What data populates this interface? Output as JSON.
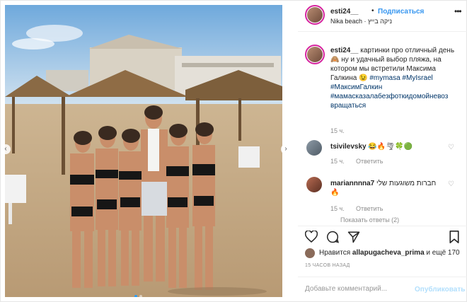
{
  "post": {
    "username": "esti24__",
    "separator": "•",
    "follow_label": "Подписаться",
    "location": "Nika beach · ניקה בייץ",
    "more_icon": "more-horizontal-icon"
  },
  "caption": {
    "username": "esti24__",
    "text": "картинки про отличный день 🙈 ну и удачный выбор пляжа, на котором мы встретили Максима Галкина 😉",
    "hashtags": "#mymasa #MyIsrael #МаксимГалкин #мамасказалабезфоткидомойневоз вращаться",
    "time": "15 ч."
  },
  "comments": [
    {
      "username": "tsivilevsky",
      "text": "😂🔥🌪🍀🟢",
      "time": "15 ч.",
      "reply_label": "Ответить"
    },
    {
      "username": "mariannnna7",
      "text": "חברות משוגעות שלי 🔥",
      "time": "15 ч.",
      "reply_label": "Ответить"
    }
  ],
  "more_replies_label": "Показать ответы (2)",
  "likes": {
    "prefix": "Нравится",
    "user": "allapugacheva_prima",
    "suffix": "и ещё 170"
  },
  "post_time": "15 ЧАСОВ НАЗАД",
  "add_comment": {
    "placeholder": "Добавьте комментарий...",
    "publish_label": "Опубликовать"
  },
  "carousel": {
    "current": 1,
    "total": 2
  },
  "colors": {
    "link_blue": "#3897f0",
    "hashtag_blue": "#003569",
    "muted_gray": "#8e8e8e",
    "border": "#efefef",
    "story_ring": "#d6249f"
  }
}
